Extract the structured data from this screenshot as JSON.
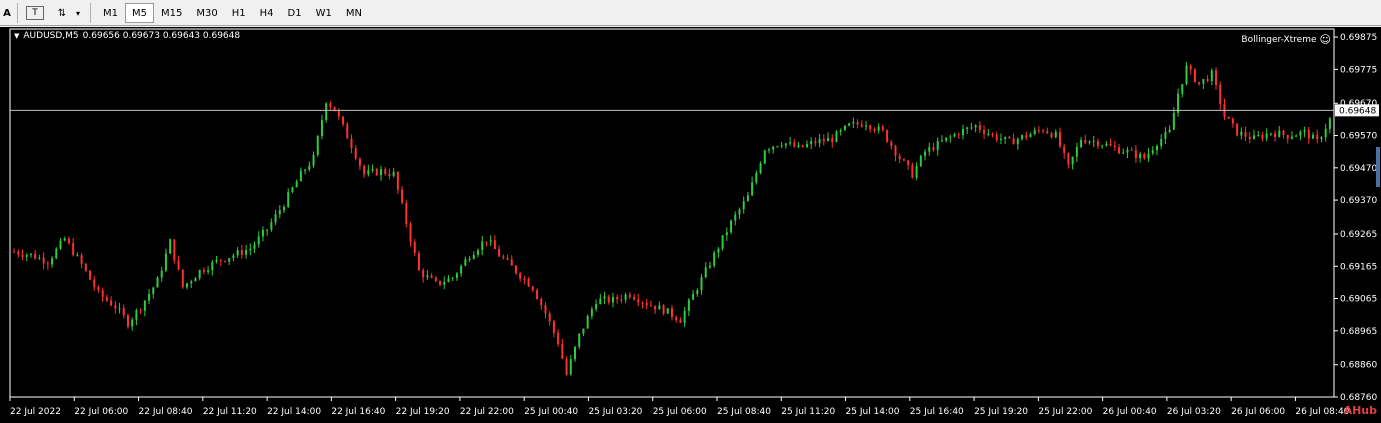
{
  "toolbar": {
    "tools": [
      {
        "name": "text-tool",
        "glyph": "A"
      },
      {
        "name": "text-label-tool",
        "glyph": "T"
      },
      {
        "name": "arrows-tool",
        "glyph": "⇅"
      }
    ],
    "dropdown_glyph": "▾",
    "timeframes": [
      {
        "label": "M1",
        "active": false
      },
      {
        "label": "M5",
        "active": true
      },
      {
        "label": "M15",
        "active": false
      },
      {
        "label": "M30",
        "active": false
      },
      {
        "label": "H1",
        "active": false
      },
      {
        "label": "H4",
        "active": false
      },
      {
        "label": "D1",
        "active": false
      },
      {
        "label": "W1",
        "active": false
      },
      {
        "label": "MN",
        "active": false
      }
    ]
  },
  "chart_header": {
    "symbol": "AUDUSD,M5",
    "ohlc": "0.69656 0.69673 0.69643 0.69648",
    "indicator": "Bollinger-Xtreme",
    "indicator_icon": "☺"
  },
  "watermark": "AHub",
  "colors": {
    "background": "#000000",
    "bull": "#2ecc40",
    "bear": "#ff3030",
    "axis_text": "#ffffff",
    "grid_line": "#ffffff",
    "bid_line": "#c0c0c0"
  },
  "chart_data": {
    "type": "candlestick",
    "symbol": "AUDUSD",
    "timeframe": "M5",
    "ylim": [
      0.6876,
      0.699
    ],
    "y_ticks": [
      "0.69875",
      "0.69775",
      "0.69670",
      "0.69570",
      "0.69470",
      "0.69370",
      "0.69265",
      "0.69165",
      "0.69065",
      "0.68965",
      "0.68860",
      "0.68760"
    ],
    "current_price": "0.69648",
    "x_ticks": [
      "22 Jul 2022",
      "22 Jul 06:00",
      "22 Jul 08:40",
      "22 Jul 11:20",
      "22 Jul 14:00",
      "22 Jul 16:40",
      "22 Jul 19:20",
      "22 Jul 22:00",
      "25 Jul 00:40",
      "25 Jul 03:20",
      "25 Jul 06:00",
      "25 Jul 08:40",
      "25 Jul 11:20",
      "25 Jul 14:00",
      "25 Jul 16:40",
      "25 Jul 19:20",
      "25 Jul 22:00",
      "26 Jul 00:40",
      "26 Jul 03:20",
      "26 Jul 06:00",
      "26 Jul 08:40"
    ],
    "price_path": [
      [
        0,
        0.6921
      ],
      [
        4,
        0.692
      ],
      [
        8,
        0.6918
      ],
      [
        12,
        0.6925
      ],
      [
        16,
        0.6917
      ],
      [
        20,
        0.6908
      ],
      [
        24,
        0.6904
      ],
      [
        27,
        0.6899
      ],
      [
        30,
        0.6904
      ],
      [
        34,
        0.6912
      ],
      [
        37,
        0.6924
      ],
      [
        40,
        0.691
      ],
      [
        44,
        0.6915
      ],
      [
        48,
        0.6918
      ],
      [
        52,
        0.692
      ],
      [
        56,
        0.6922
      ],
      [
        60,
        0.6928
      ],
      [
        64,
        0.6936
      ],
      [
        68,
        0.6945
      ],
      [
        71,
        0.695
      ],
      [
        74,
        0.6968
      ],
      [
        76,
        0.6965
      ],
      [
        80,
        0.6954
      ],
      [
        83,
        0.6945
      ],
      [
        87,
        0.6946
      ],
      [
        90,
        0.6945
      ],
      [
        93,
        0.693
      ],
      [
        96,
        0.6915
      ],
      [
        100,
        0.6911
      ],
      [
        104,
        0.6913
      ],
      [
        108,
        0.692
      ],
      [
        112,
        0.6925
      ],
      [
        115,
        0.692
      ],
      [
        119,
        0.6915
      ],
      [
        123,
        0.691
      ],
      [
        126,
        0.6902
      ],
      [
        129,
        0.6893
      ],
      [
        131,
        0.6883
      ],
      [
        134,
        0.6895
      ],
      [
        138,
        0.6906
      ],
      [
        142,
        0.6906
      ],
      [
        146,
        0.6908
      ],
      [
        150,
        0.6905
      ],
      [
        154,
        0.6903
      ],
      [
        158,
        0.69
      ],
      [
        162,
        0.691
      ],
      [
        166,
        0.692
      ],
      [
        170,
        0.693
      ],
      [
        174,
        0.6938
      ],
      [
        178,
        0.6953
      ],
      [
        182,
        0.6955
      ],
      [
        186,
        0.6953
      ],
      [
        190,
        0.6955
      ],
      [
        194,
        0.6956
      ],
      [
        198,
        0.696
      ],
      [
        202,
        0.6961
      ],
      [
        206,
        0.6958
      ],
      [
        210,
        0.695
      ],
      [
        213,
        0.6945
      ],
      [
        216,
        0.6952
      ],
      [
        220,
        0.6955
      ],
      [
        224,
        0.6958
      ],
      [
        228,
        0.696
      ],
      [
        232,
        0.6957
      ],
      [
        236,
        0.6955
      ],
      [
        240,
        0.6957
      ],
      [
        244,
        0.6959
      ],
      [
        247,
        0.6957
      ],
      [
        250,
        0.6947
      ],
      [
        253,
        0.6956
      ],
      [
        257,
        0.6955
      ],
      [
        261,
        0.6953
      ],
      [
        264,
        0.6952
      ],
      [
        268,
        0.695
      ],
      [
        271,
        0.6955
      ],
      [
        274,
        0.6958
      ],
      [
        276,
        0.697
      ],
      [
        278,
        0.6978
      ],
      [
        281,
        0.6973
      ],
      [
        284,
        0.6976
      ],
      [
        287,
        0.6963
      ],
      [
        290,
        0.6958
      ],
      [
        294,
        0.6956
      ],
      [
        298,
        0.6958
      ],
      [
        302,
        0.6957
      ],
      [
        306,
        0.6958
      ],
      [
        309,
        0.6955
      ],
      [
        312,
        0.6962
      ]
    ]
  }
}
